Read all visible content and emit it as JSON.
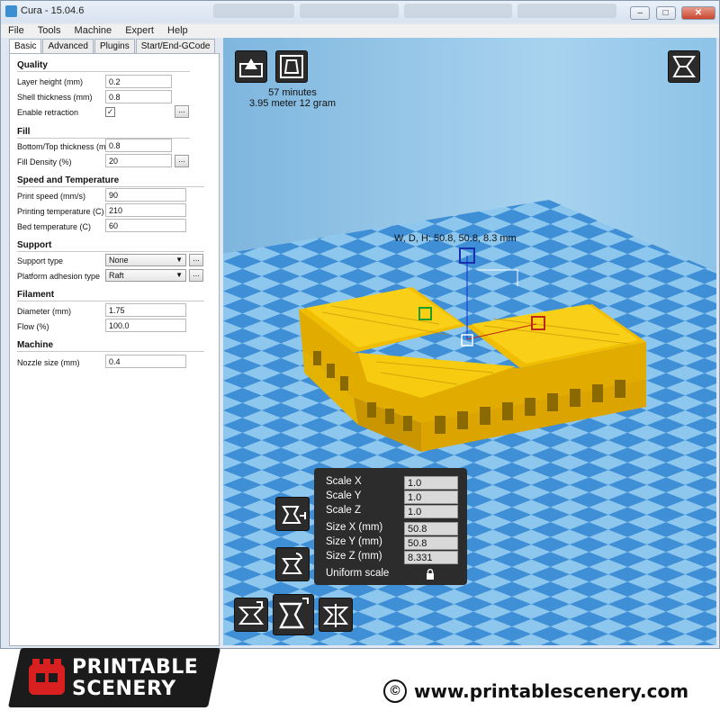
{
  "window": {
    "title": "Cura - 15.04.6",
    "controls": [
      "–",
      "□",
      "✕"
    ]
  },
  "menu": [
    "File",
    "Tools",
    "Machine",
    "Expert",
    "Help"
  ],
  "tabs": [
    "Basic",
    "Advanced",
    "Plugins",
    "Start/End-GCode"
  ],
  "settings": {
    "quality": {
      "title": "Quality",
      "layer_height_label": "Layer height (mm)",
      "layer_height": "0.2",
      "shell_label": "Shell thickness (mm)",
      "shell": "0.8",
      "retraction_label": "Enable retraction",
      "retraction": "✓"
    },
    "fill": {
      "title": "Fill",
      "bottom_top_label": "Bottom/Top thickness (mm)",
      "bottom_top": "0.8",
      "density_label": "Fill Density (%)",
      "density": "20"
    },
    "speed": {
      "title": "Speed and Temperature",
      "print_speed_label": "Print speed (mm/s)",
      "print_speed": "90",
      "print_temp_label": "Printing temperature (C)",
      "print_temp": "210",
      "bed_temp_label": "Bed temperature (C)",
      "bed_temp": "60"
    },
    "support": {
      "title": "Support",
      "support_type_label": "Support type",
      "support_type": "None",
      "adhesion_label": "Platform adhesion type",
      "adhesion": "Raft"
    },
    "filament": {
      "title": "Filament",
      "diameter_label": "Diameter (mm)",
      "diameter": "1.75",
      "flow_label": "Flow (%)",
      "flow": "100.0"
    },
    "machine": {
      "title": "Machine",
      "nozzle_label": "Nozzle size (mm)",
      "nozzle": "0.4"
    },
    "dots_label": "..."
  },
  "viewport": {
    "print_time": "57 minutes",
    "print_material": "3.95 meter 12 gram",
    "dimensions": "W, D, H: 50.8, 50.8, 8.3 mm",
    "scale": {
      "scale_x_label": "Scale X",
      "scale_x": "1.0",
      "scale_y_label": "Scale Y",
      "scale_y": "1.0",
      "scale_z_label": "Scale Z",
      "scale_z": "1.0",
      "size_x_label": "Size X (mm)",
      "size_x": "50.8",
      "size_y_label": "Size Y (mm)",
      "size_y": "50.8",
      "size_z_label": "Size Z (mm)",
      "size_z": "8.331",
      "uniform_label": "Uniform scale"
    }
  },
  "footer": {
    "brand_line1": "PRINTABLE",
    "brand_line2": "SCENERY",
    "copyright_symbol": "©",
    "website": "www.printablescenery.com"
  },
  "colors": {
    "floor_dark": "#3f8fd6",
    "floor_light": "#8ec7ee",
    "wall": "#9fcbe8",
    "model": "#f5c400",
    "panel": "#2c2c2c"
  },
  "icons": [
    "load-icon",
    "save-gcode-icon",
    "view-mode-icon",
    "scale-tool-icon",
    "mirror-tool-icon",
    "rotate-tool-icon",
    "scale-mode-icon",
    "mirror-mode-icon",
    "lock-icon"
  ]
}
